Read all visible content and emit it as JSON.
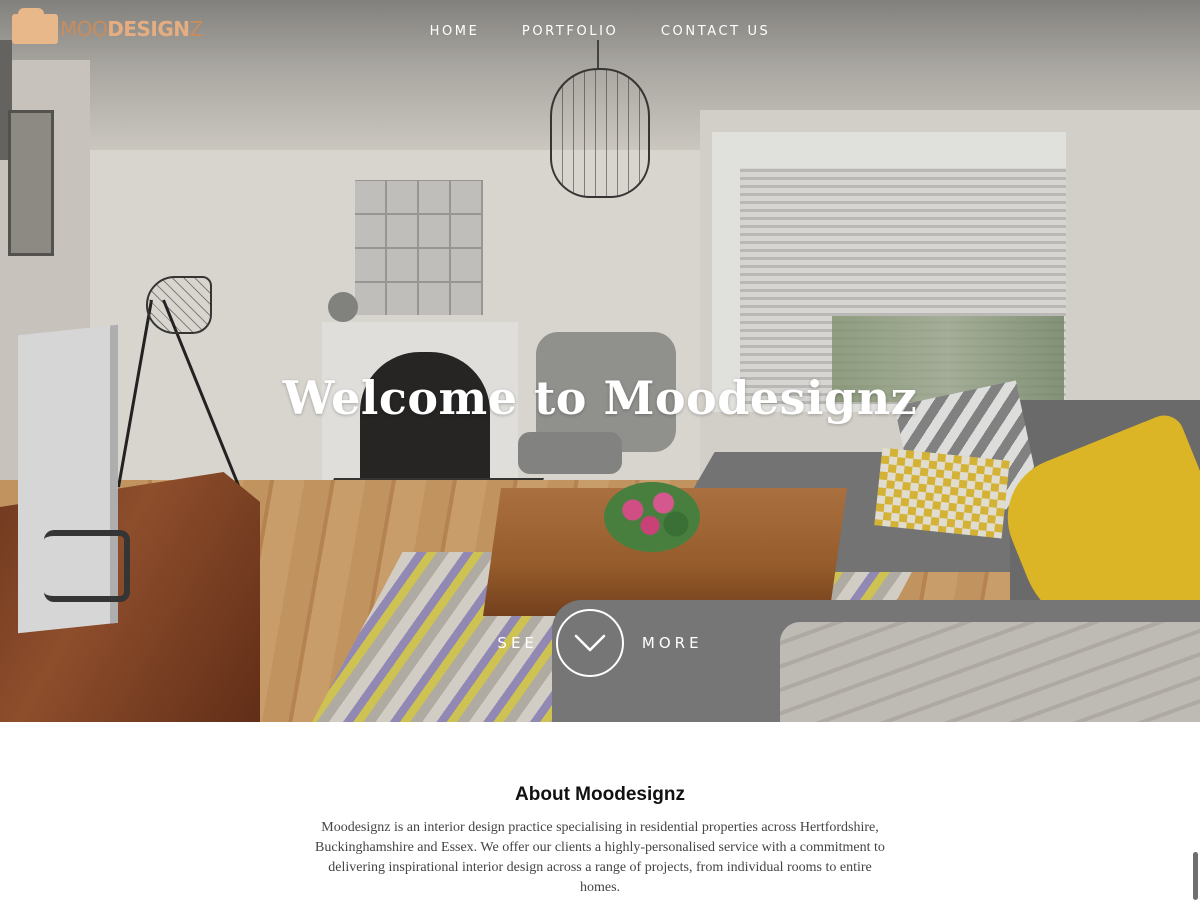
{
  "brand": {
    "logo_text_light": "MOO",
    "logo_text_bold": "DESIGN",
    "logo_text_end": "Z"
  },
  "nav": {
    "items": [
      {
        "label": "HOME"
      },
      {
        "label": "PORTFOLIO"
      },
      {
        "label": "CONTACT US"
      }
    ]
  },
  "hero": {
    "title": "Welcome to Moodesignz",
    "cta_left": "SEE",
    "cta_right": "MORE",
    "cta_icon": "chevron-down-icon"
  },
  "about": {
    "title": "About Moodesignz",
    "body": "Moodesignz is an interior design practice specialising in residential properties across Hertfordshire, Buckinghamshire and Essex. We offer our clients a highly-personalised service with a commitment to delivering inspirational interior design across a range of projects, from individual rooms to entire homes."
  },
  "colors": {
    "logo_accent": "#e6ad80",
    "nav_text": "#ffffff",
    "heading_text": "#111111",
    "body_text": "#444444"
  }
}
